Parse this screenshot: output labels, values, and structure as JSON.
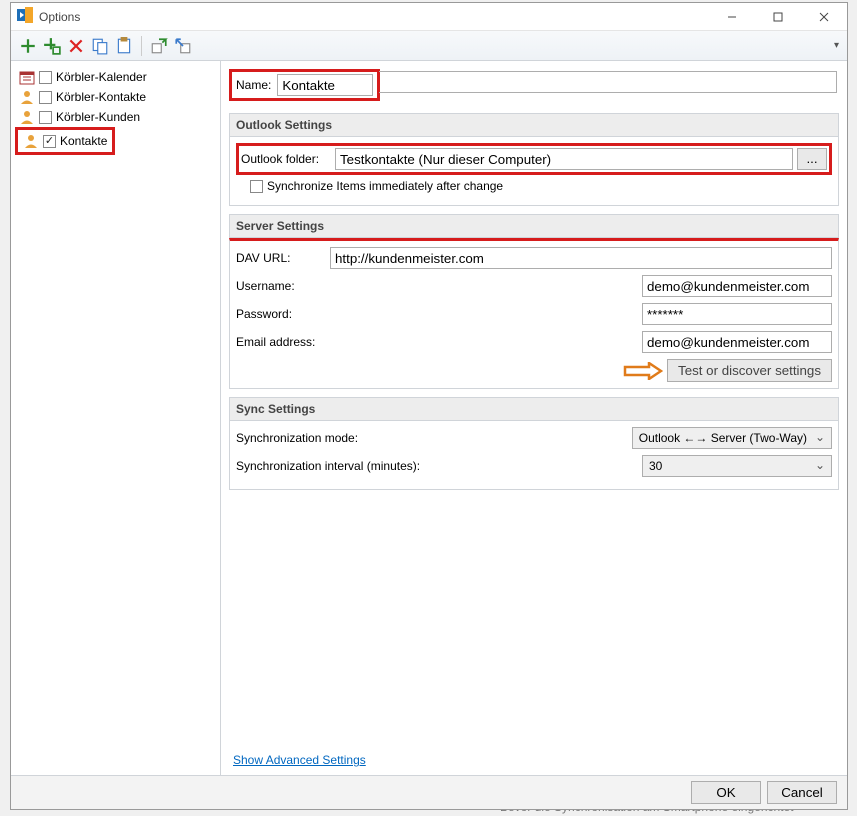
{
  "window": {
    "title": "Options"
  },
  "sidebar": {
    "items": [
      {
        "label": "Körbler-Kalender",
        "checked": false
      },
      {
        "label": "Körbler-Kontakte",
        "checked": false
      },
      {
        "label": "Körbler-Kunden",
        "checked": false
      },
      {
        "label": "Kontakte",
        "checked": true
      }
    ]
  },
  "form": {
    "name_label": "Name:",
    "name_value": "Kontakte"
  },
  "outlook": {
    "heading": "Outlook Settings",
    "folder_label": "Outlook folder:",
    "folder_value": "Testkontakte (Nur dieser Computer)",
    "browse_label": "...",
    "sync_immediate_label": "Synchronize Items immediately after change"
  },
  "server": {
    "heading": "Server Settings",
    "dav_label": "DAV URL:",
    "dav_value": "http://kundenmeister.com",
    "user_label": "Username:",
    "user_value": "demo@kundenmeister.com",
    "pass_label": "Password:",
    "pass_value": "*******",
    "email_label": "Email address:",
    "email_value": "demo@kundenmeister.com",
    "test_label": "Test or discover settings"
  },
  "sync": {
    "heading": "Sync Settings",
    "mode_label": "Synchronization mode:",
    "mode_value": "Outlook ←→ Server (Two-Way)",
    "interval_label": "Synchronization interval (minutes):",
    "interval_value": "30"
  },
  "advanced_link": "Show Advanced Settings",
  "buttons": {
    "ok": "OK",
    "cancel": "Cancel"
  },
  "background_text": "Bevor die Synchronisation am Smartphone eingerichtet"
}
